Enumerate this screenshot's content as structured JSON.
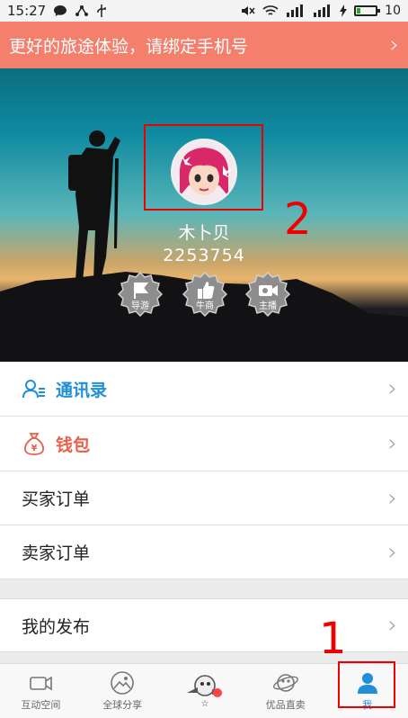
{
  "statusbar": {
    "time": "15:27",
    "battery": "10"
  },
  "banner": {
    "text": "更好的旅途体验，请绑定手机号"
  },
  "profile": {
    "name": "木卜贝",
    "id": "2253754",
    "badges": [
      {
        "label": "导游",
        "icon": "flag-icon"
      },
      {
        "label": "牛商",
        "icon": "thumbs-up-icon"
      },
      {
        "label": "主播",
        "icon": "video-camera-icon"
      }
    ]
  },
  "annotations": {
    "one": "1",
    "two": "2"
  },
  "menu": {
    "contacts": "通讯录",
    "wallet": "钱包",
    "buyer_orders": "买家订单",
    "seller_orders": "卖家订单",
    "my_posts": "我的发布"
  },
  "tabs": [
    {
      "label": "互动空间",
      "icon": "video-camera-icon"
    },
    {
      "label": "全球分享",
      "icon": "photo-icon"
    },
    {
      "label": "",
      "icon": "mascot-icon"
    },
    {
      "label": "优品直卖",
      "icon": "planet-icon"
    },
    {
      "label": "我",
      "icon": "person-icon"
    }
  ],
  "colors": {
    "banner": "#f37f6c",
    "accent": "#1e8fd8",
    "wallet": "#e8604c",
    "annotation": "#e00000"
  }
}
